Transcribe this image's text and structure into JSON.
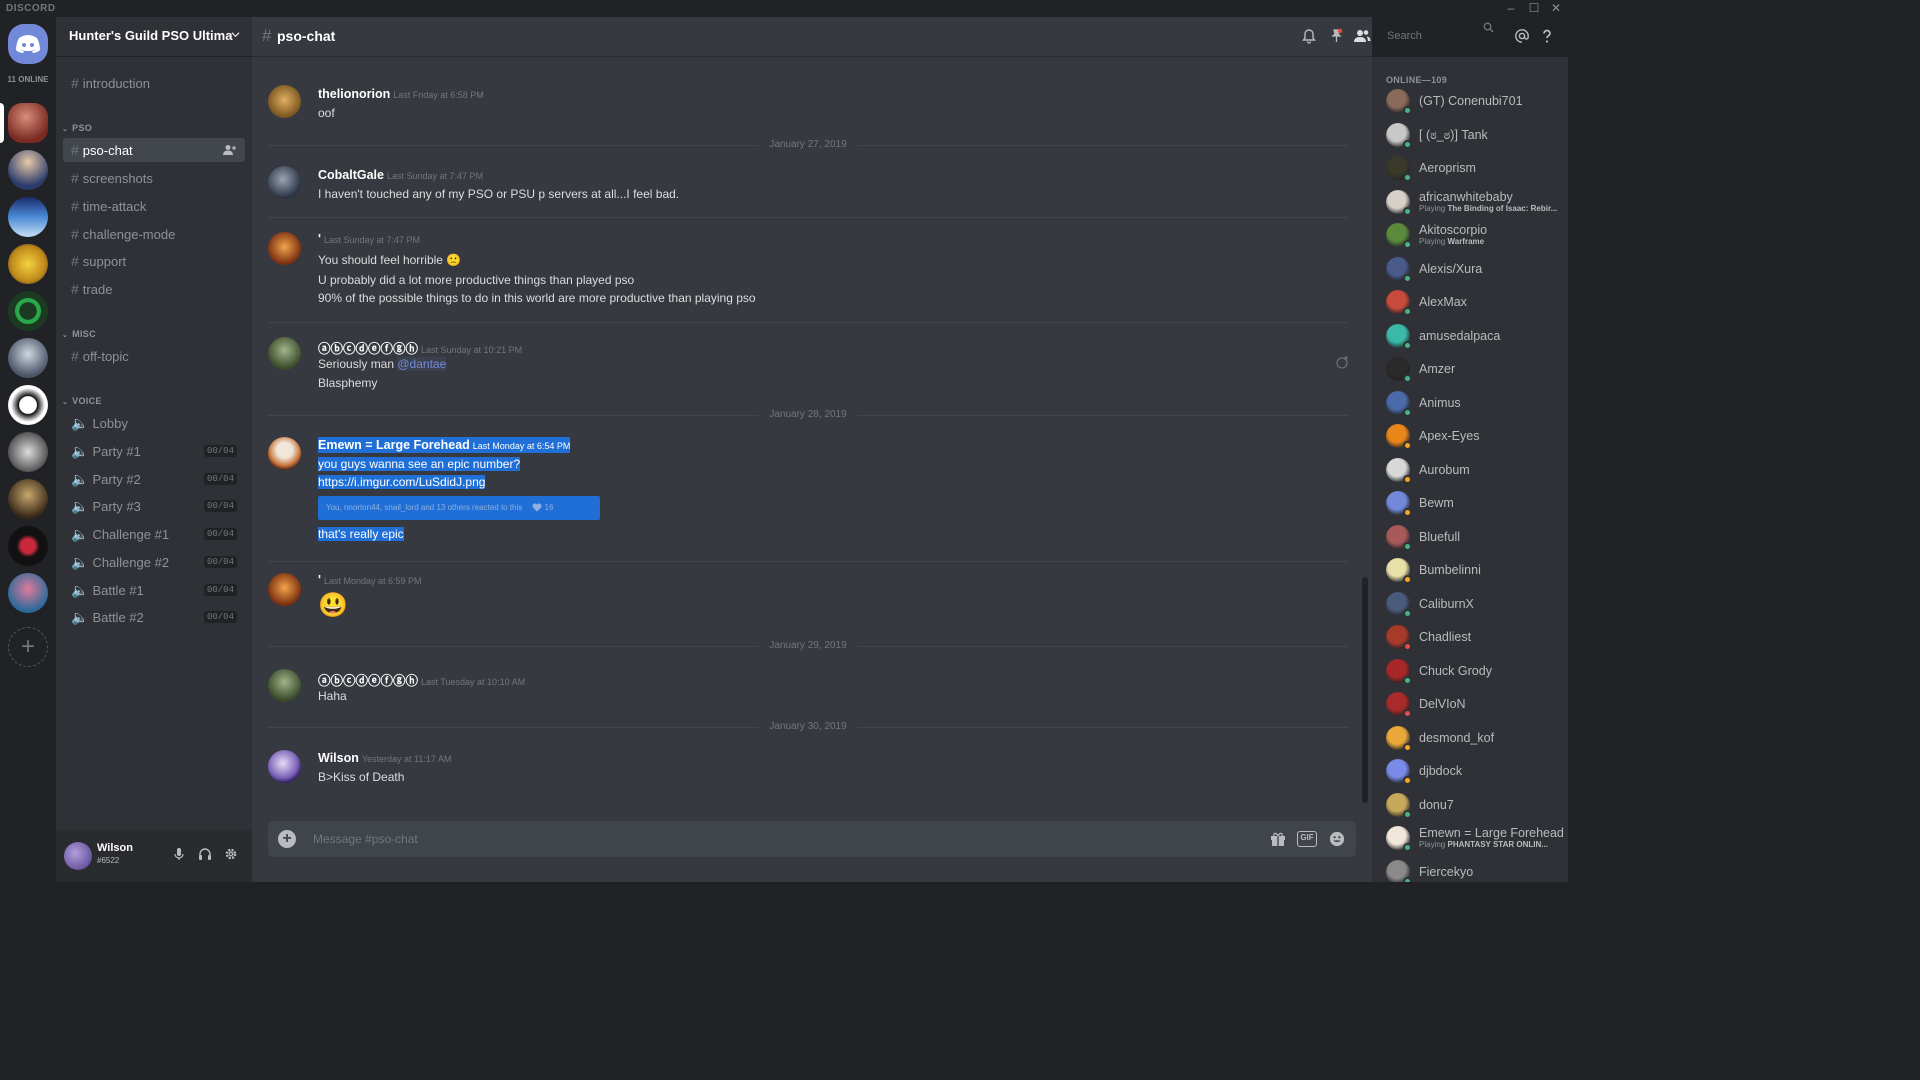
{
  "window": {
    "brand": "DISCORD",
    "minimize": "–",
    "maximize": "☐",
    "close": "✕"
  },
  "guild_rail": {
    "online_label": "11 ONLINE"
  },
  "guild": {
    "name": "Hunter's Guild PSO Ultima"
  },
  "channels": {
    "top": [
      {
        "name": "introduction"
      }
    ],
    "categories": [
      {
        "name": "PSO",
        "items": [
          {
            "name": "pso-chat",
            "active": true
          },
          {
            "name": "screenshots"
          },
          {
            "name": "time-attack"
          },
          {
            "name": "challenge-mode"
          },
          {
            "name": "support"
          },
          {
            "name": "trade"
          }
        ]
      },
      {
        "name": "MISC",
        "items": [
          {
            "name": "off-topic"
          }
        ]
      },
      {
        "name": "VOICE",
        "items": [
          {
            "name": "Lobby"
          },
          {
            "name": "Party #1",
            "count": "00/04"
          },
          {
            "name": "Party #2",
            "count": "00/04"
          },
          {
            "name": "Party #3",
            "count": "00/04"
          },
          {
            "name": "Challenge #1",
            "count": "00/04"
          },
          {
            "name": "Challenge #2",
            "count": "00/04"
          },
          {
            "name": "Battle #1",
            "count": "00/04"
          },
          {
            "name": "Battle #2",
            "count": "00/04"
          }
        ]
      }
    ]
  },
  "user": {
    "name": "Wilson",
    "tag": "#6522"
  },
  "header": {
    "channel": "pso-chat",
    "search_placeholder": "Search"
  },
  "messages": [
    {
      "author": "thelionorion",
      "time": "Last Friday at 6:58 PM",
      "lines": [
        "oof"
      ]
    },
    {
      "divider": "January 27, 2019"
    },
    {
      "author": "CobaltGale",
      "time": "Last Sunday at 7:47 PM",
      "lines": [
        "I haven't touched any of my PSO or PSU p servers at all...I feel bad."
      ]
    },
    {
      "author": "'",
      "time": "Last Sunday at 7:47 PM",
      "lines": [
        "You should feel horrible",
        "U probably did a lot more productive things than played pso",
        "90% of the possible things to do in this world are more productive than playing pso"
      ]
    },
    {
      "author": "ⓐⓑⓒⓓⓔⓕⓖⓗ",
      "time": "Last Sunday at 10:21 PM",
      "lines": [
        "Seriously man",
        "Blasphemy"
      ],
      "mention": "@dantae"
    },
    {
      "divider": "January 28, 2019"
    },
    {
      "author": "Emewn = Large Forehead",
      "time": "Last Monday at 6:54 PM",
      "lines": [
        "you guys wanna see an epic number?",
        "https://i.imgur.com/LuSdidJ.png",
        "that's really epic"
      ],
      "reaction": "You, nnorton44, snail_lord and 13 others reacted to this",
      "reaction_count": "16"
    },
    {
      "author": "'",
      "time": "Last Monday at 6:59 PM",
      "lines": [
        "😃"
      ]
    },
    {
      "divider": "January 29, 2019"
    },
    {
      "author": "ⓐⓑⓒⓓⓔⓕⓖⓗ",
      "time": "Last Tuesday at 10:10 AM",
      "lines": [
        "Haha"
      ]
    },
    {
      "divider": "January 30, 2019"
    },
    {
      "author": "Wilson",
      "time": "Yesterday at 11:17 AM",
      "lines": [
        "B>Kiss of Death"
      ]
    }
  ],
  "composer": {
    "placeholder": "Message #pso-chat",
    "gif_label": "GIF"
  },
  "members": {
    "heading": "ONLINE—109",
    "list": [
      {
        "name": "(GT) Conenubi701",
        "status_color": "#43b581"
      },
      {
        "name": "[ (ಠ_ಠ)] Tank",
        "status_color": "#43b581"
      },
      {
        "name": "Aeroprism",
        "status_color": "#43b581"
      },
      {
        "name": "africanwhitebaby",
        "activity_prefix": "Playing",
        "activity": "The Binding of Isaac: Rebir...",
        "status_color": "#43b581"
      },
      {
        "name": "Akitoscorpio",
        "activity_prefix": "Playing",
        "activity": "Warframe",
        "status_color": "#43b581"
      },
      {
        "name": "Alexis/Xura",
        "status_color": "#43b581"
      },
      {
        "name": "AlexMax",
        "status_color": "#43b581"
      },
      {
        "name": "amusedalpaca",
        "status_color": "#43b581"
      },
      {
        "name": "Amzer",
        "status_color": "#43b581"
      },
      {
        "name": "Animus",
        "status_color": "#43b581"
      },
      {
        "name": "Apex-Eyes",
        "status_color": "#faa61a"
      },
      {
        "name": "Aurobum",
        "status_color": "#faa61a"
      },
      {
        "name": "Bewm",
        "status_color": "#faa61a"
      },
      {
        "name": "Bluefull",
        "status_color": "#43b581"
      },
      {
        "name": "Bumbelinni",
        "status_color": "#faa61a"
      },
      {
        "name": "CaliburnX",
        "status_color": "#43b581"
      },
      {
        "name": "Chadliest",
        "status_color": "#f04747"
      },
      {
        "name": "Chuck Grody",
        "status_color": "#43b581"
      },
      {
        "name": "DelVIoN",
        "status_color": "#f04747"
      },
      {
        "name": "desmond_kof",
        "status_color": "#faa61a"
      },
      {
        "name": "djbdock",
        "status_color": "#faa61a"
      },
      {
        "name": "donu7",
        "status_color": "#43b581"
      },
      {
        "name": "Emewn = Large Forehead",
        "activity_prefix": "Playing",
        "activity": "PHANTASY STAR ONLIN...",
        "status_color": "#43b581"
      },
      {
        "name": "Fiercekyo",
        "status_color": "#43b581"
      }
    ]
  },
  "colors": {
    "accent": "#7289da",
    "online": "#43b581",
    "idle": "#faa61a",
    "dnd": "#f04747",
    "highlight": "#1f6fd6"
  }
}
